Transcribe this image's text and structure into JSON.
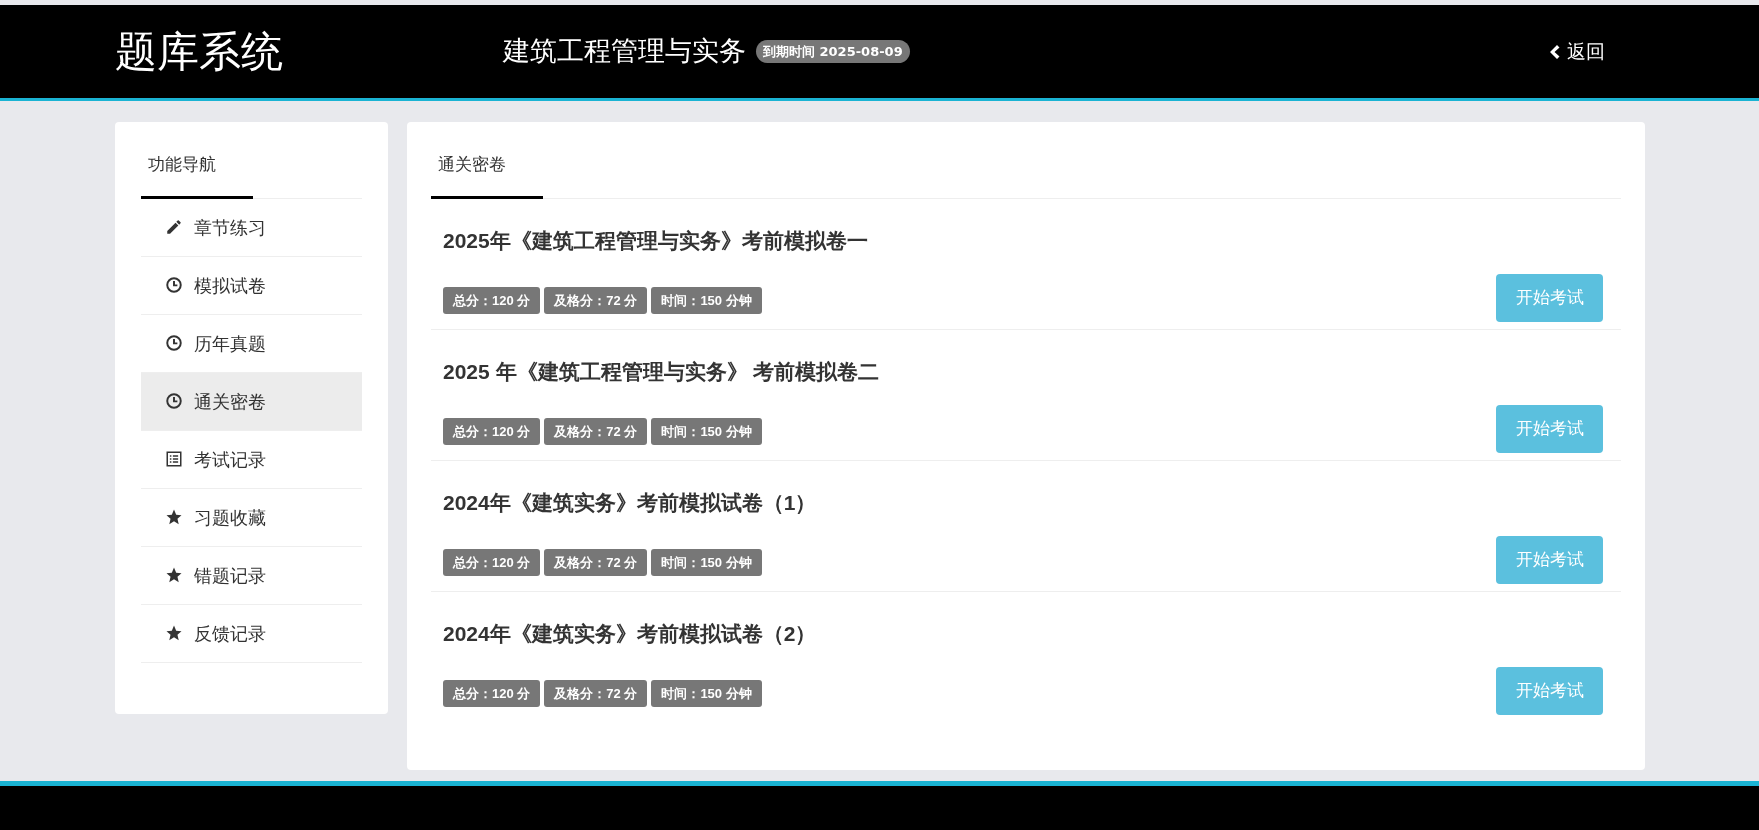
{
  "header": {
    "logo": "题库系统",
    "course": "建筑工程管理与实务",
    "expiry_badge": "到期时间 2025-08-09",
    "back": "返回"
  },
  "sidebar": {
    "tab": "功能导航",
    "items": [
      {
        "label": "章节练习",
        "kind": "pencil",
        "selected": false
      },
      {
        "label": "模拟试卷",
        "kind": "clock",
        "selected": false
      },
      {
        "label": "历年真题",
        "kind": "clock",
        "selected": false
      },
      {
        "label": "通关密卷",
        "kind": "clock",
        "selected": true
      },
      {
        "label": "考试记录",
        "kind": "list",
        "selected": false
      },
      {
        "label": "习题收藏",
        "kind": "star",
        "selected": false
      },
      {
        "label": "错题记录",
        "kind": "star",
        "selected": false
      },
      {
        "label": "反馈记录",
        "kind": "star",
        "selected": false
      }
    ]
  },
  "main": {
    "tab": "通关密卷",
    "papers": [
      {
        "title": "2025年《建筑工程管理与实务》考前模拟卷一",
        "tags": [
          "总分：120 分",
          "及格分：72 分",
          "时间：150 分钟"
        ],
        "button": "开始考试"
      },
      {
        "title": "2025 年《建筑工程管理与实务》 考前模拟卷二",
        "tags": [
          "总分：120 分",
          "及格分：72 分",
          "时间：150 分钟"
        ],
        "button": "开始考试"
      },
      {
        "title": "2024年《建筑实务》考前模拟试卷（1）",
        "tags": [
          "总分：120 分",
          "及格分：72 分",
          "时间：150 分钟"
        ],
        "button": "开始考试"
      },
      {
        "title": "2024年《建筑实务》考前模拟试卷（2）",
        "tags": [
          "总分：120 分",
          "及格分：72 分",
          "时间：150 分钟"
        ],
        "button": "开始考试"
      }
    ]
  }
}
